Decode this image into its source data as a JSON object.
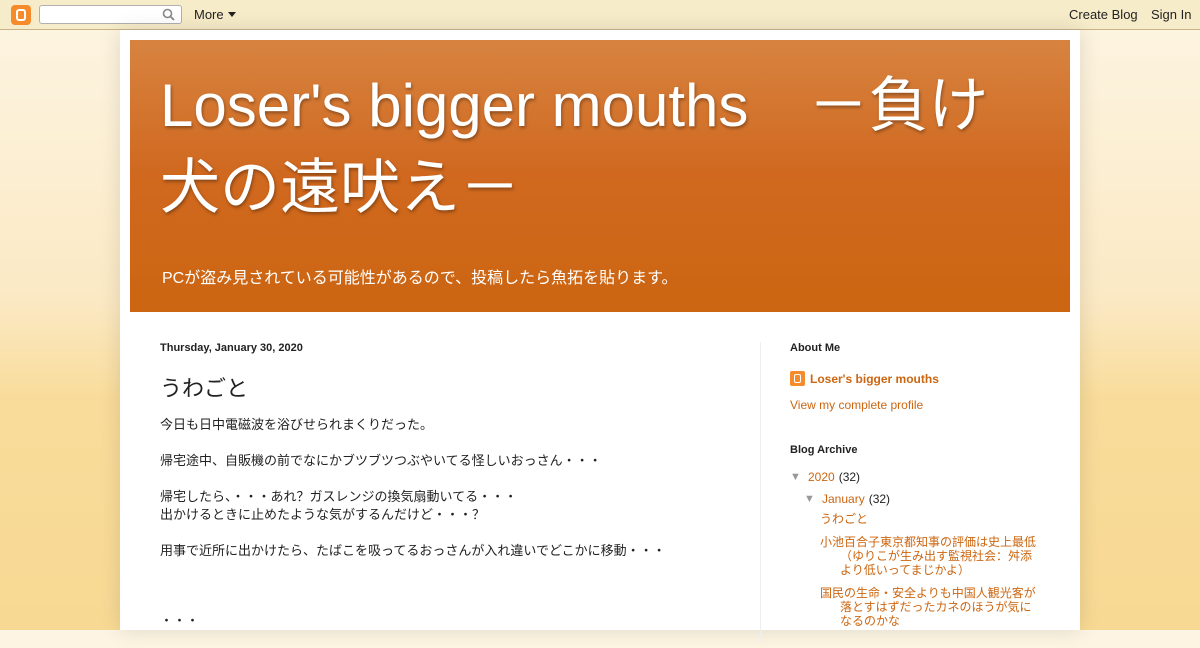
{
  "navbar": {
    "search_placeholder": "",
    "more_label": "More",
    "create_blog_label": "Create Blog",
    "sign_in_label": "Sign In"
  },
  "header": {
    "title": "Loser's bigger mouths　－負け犬の遠吠え－",
    "description": "PCが盗み見されている可能性があるので、投稿したら魚拓を貼ります。"
  },
  "post": {
    "date": "Thursday, January 30, 2020",
    "title": "うわごと",
    "paragraphs": [
      "今日も日中電磁波を浴びせられまくりだった。",
      "帰宅途中、自販機の前でなにかブツブツつぶやいてる怪しいおっさん・・・",
      "帰宅したら、・・・あれ？ガスレンジの換気扇動いてる・・・",
      "出かけるときに止めたような気がするんだけど・・・？",
      "用事で近所に出かけたら、たばこを吸ってるおっさんが入れ違いでどこかに移動・・・",
      "・・・"
    ]
  },
  "sidebar": {
    "about_title": "About Me",
    "profile_name": "Loser's bigger mouths",
    "profile_link": "View my complete profile",
    "archive_title": "Blog Archive",
    "year": {
      "toggle": "▼",
      "label": "2020",
      "count": "(32)"
    },
    "month": {
      "toggle": "▼",
      "label": "January",
      "count": "(32)"
    },
    "posts": [
      "うわごと",
      "小池百合子東京都知事の評価は史上最低（ゆりこが生み出す監視社会：舛添より低いってまじかよ）",
      "国民の生命・安全よりも中国人観光客が落とすはずだったカネのほうが気になるのかな"
    ]
  },
  "colors": {
    "accent": "#cc6611",
    "header_top": "#d78340",
    "header_bottom": "#cc6611",
    "blogger_orange": "#f68b2c"
  }
}
